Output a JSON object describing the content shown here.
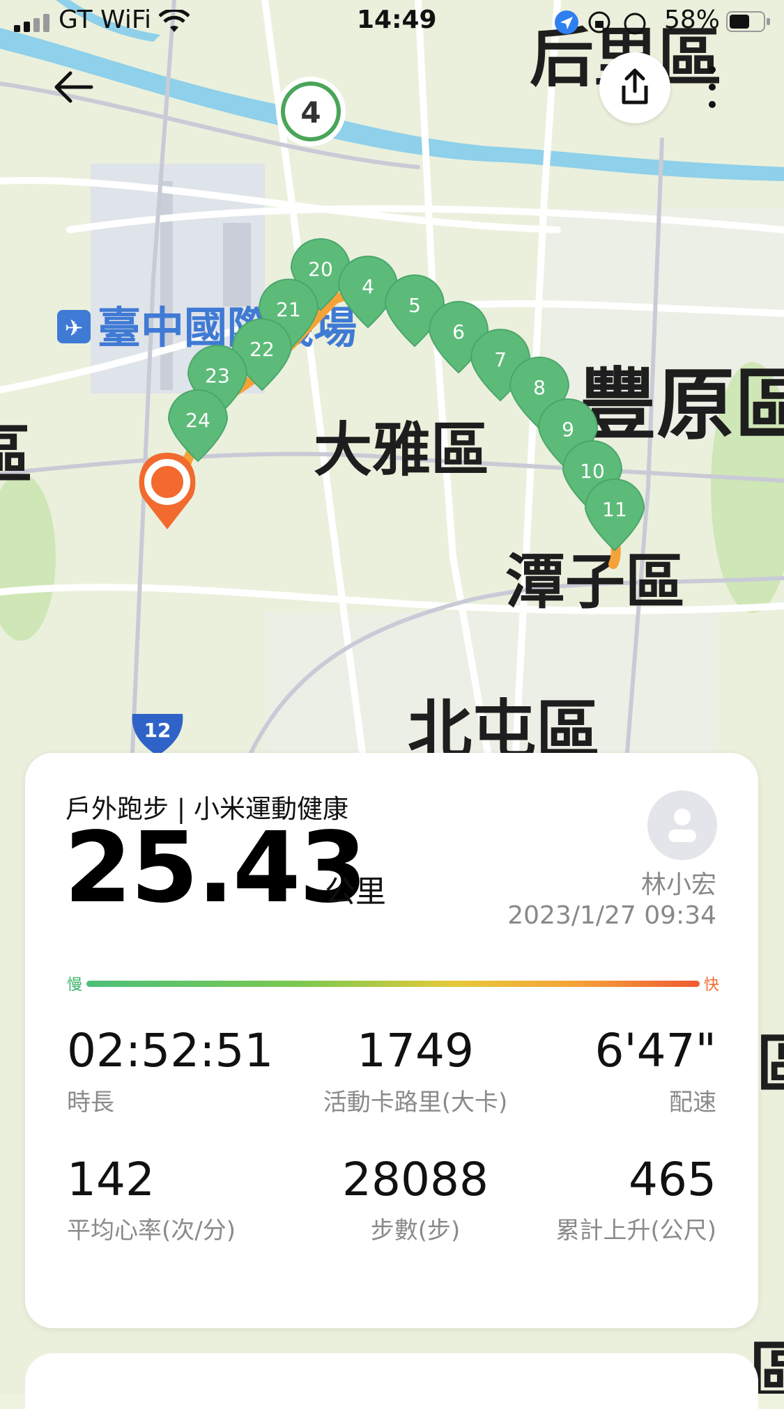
{
  "status_bar": {
    "carrier": "GT WiFi",
    "time": "14:49",
    "battery": "58%"
  },
  "map": {
    "district_labels": [
      "后里區",
      "臺中國際機場",
      "豐原區",
      "大雅區",
      "潭子區",
      "北屯區",
      "區",
      "區",
      "區"
    ],
    "route_badge": "4",
    "highway_shield": "12",
    "km_markers": [
      "20",
      "4",
      "5",
      "6",
      "7",
      "8",
      "9",
      "10",
      "11",
      "21",
      "22",
      "23",
      "24"
    ]
  },
  "nav": {
    "back_icon": "arrow-left-icon",
    "share_icon": "share-icon",
    "more_icon": "more-vertical-icon"
  },
  "summary": {
    "subtitle": "戶外跑步 | 小米運動健康",
    "distance": "25.43",
    "unit": "公里",
    "user_name": "林小宏",
    "datetime": "2023/1/27 09:34",
    "pace_slow": "慢",
    "pace_fast": "快"
  },
  "stats": [
    {
      "value": "02:52:51",
      "label": "時長"
    },
    {
      "value": "1749",
      "label": "活動卡路里(大卡)"
    },
    {
      "value": "6'47\"",
      "label": "配速"
    },
    {
      "value": "142",
      "label": "平均心率(次/分)"
    },
    {
      "value": "28088",
      "label": "步數(步)"
    },
    {
      "value": "465",
      "label": "累計上升(公尺)"
    }
  ],
  "colors": {
    "route_start": "#4cbf7a",
    "route_end": "#ef5a34",
    "marker_green": "#5dbb7a",
    "start_pin": "#f26a2e"
  }
}
